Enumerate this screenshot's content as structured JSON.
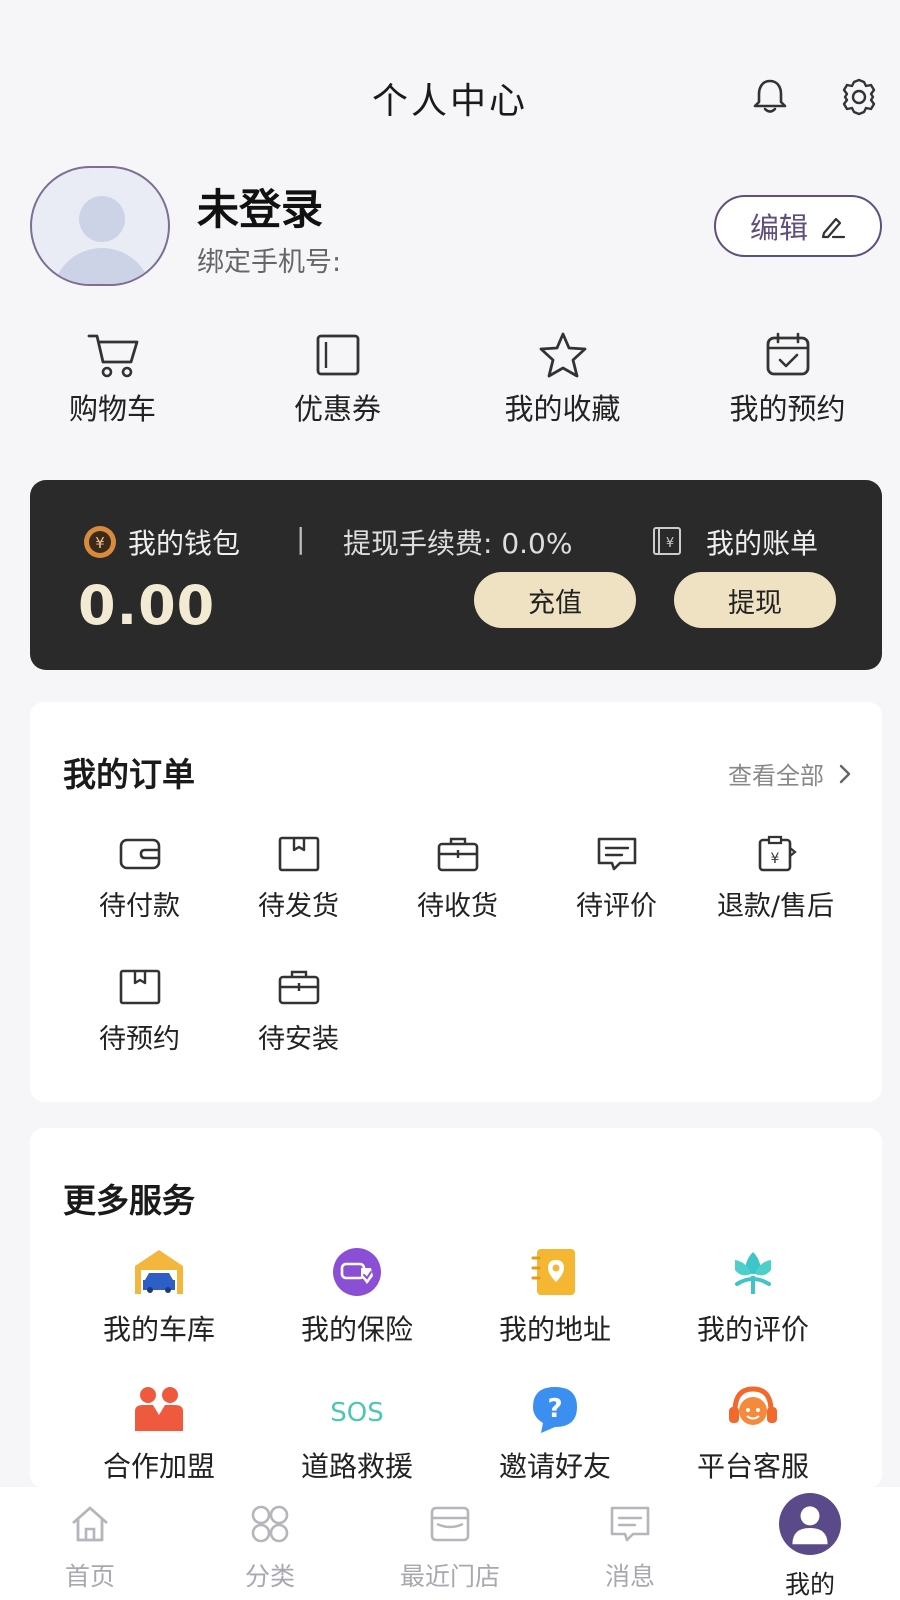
{
  "header": {
    "title": "个人中心"
  },
  "profile": {
    "name": "未登录",
    "phone_label": "绑定手机号:",
    "edit_label": "编辑"
  },
  "quick_links": [
    {
      "label": "购物车",
      "icon": "cart-icon"
    },
    {
      "label": "优惠券",
      "icon": "coupon-icon"
    },
    {
      "label": "我的收藏",
      "icon": "star-icon"
    },
    {
      "label": "我的预约",
      "icon": "calendar-icon"
    }
  ],
  "wallet": {
    "title": "我的钱包",
    "separator": "|",
    "fee": "提现手续费: 0.0%",
    "bill": "我的账单",
    "balance": "0.00",
    "recharge_label": "充值",
    "withdraw_label": "提现"
  },
  "orders": {
    "title": "我的订单",
    "view_all": "查看全部",
    "items": [
      {
        "label": "待付款",
        "icon": "wallet-icon"
      },
      {
        "label": "待发货",
        "icon": "box-icon"
      },
      {
        "label": "待收货",
        "icon": "briefcase-icon"
      },
      {
        "label": "待评价",
        "icon": "comment-icon"
      },
      {
        "label": "退款/售后",
        "icon": "refund-icon"
      },
      {
        "label": "待预约",
        "icon": "box-icon"
      },
      {
        "label": "待安装",
        "icon": "briefcase-icon"
      }
    ]
  },
  "services": {
    "title": "更多服务",
    "sos_text": "SOS",
    "items": [
      {
        "label": "我的车库",
        "icon": "garage-icon"
      },
      {
        "label": "我的保险",
        "icon": "insurance-icon"
      },
      {
        "label": "我的地址",
        "icon": "address-icon"
      },
      {
        "label": "我的评价",
        "icon": "flower-icon"
      },
      {
        "label": "合作加盟",
        "icon": "partners-icon"
      },
      {
        "label": "道路救援",
        "icon": "sos-icon"
      },
      {
        "label": "邀请好友",
        "icon": "question-icon"
      },
      {
        "label": "平台客服",
        "icon": "headset-icon"
      }
    ]
  },
  "tabbar": [
    {
      "label": "首页",
      "icon": "home-icon"
    },
    {
      "label": "分类",
      "icon": "category-icon"
    },
    {
      "label": "最近门店",
      "icon": "store-icon"
    },
    {
      "label": "消息",
      "icon": "message-icon"
    },
    {
      "label": "我的",
      "icon": "user-icon"
    }
  ],
  "colors": {
    "accent": "#5b4a89",
    "wallet_bg": "#2a2a2a",
    "wallet_button": "#eee2c3",
    "wallet_amount": "#f2ead2"
  }
}
